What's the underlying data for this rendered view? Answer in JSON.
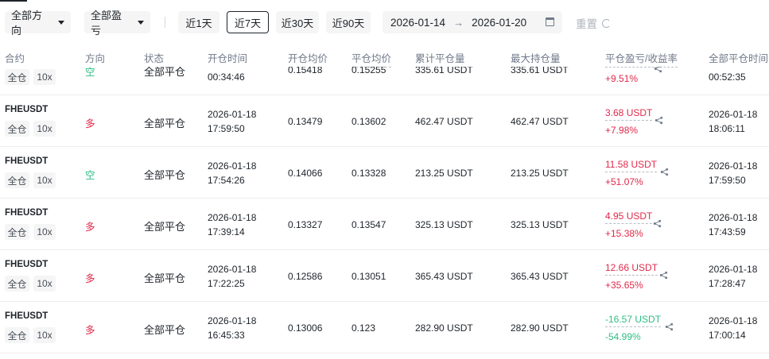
{
  "filters": {
    "direction": "全部方向",
    "pnl": "全部盈亏",
    "ranges": [
      "近1天",
      "近7天",
      "近30天",
      "近90天"
    ],
    "active_range": 1,
    "date_start": "2026-01-14",
    "date_end": "2026-01-20",
    "reset_label": "重置"
  },
  "columns": {
    "symbol": "合约",
    "side": "方向",
    "status": "状态",
    "open_time": "开仓时间",
    "open_avg": "开仓均价",
    "close_avg": "平仓均价",
    "cum_close": "累计平仓量",
    "max_hold": "最大持仓量",
    "pnl": "平仓盈亏/收益率",
    "close_time": "全部平仓时间"
  },
  "colors": {
    "long": "#e0294a",
    "short": "#2ebd85",
    "profit": "#e0294a",
    "loss": "#2ebd85"
  },
  "rows": [
    {
      "symbol": "",
      "margin": "全仓",
      "leverage": "10x",
      "side": "空",
      "side_type": "short",
      "status": "全部平仓",
      "open_date": "",
      "open_time": "00:34:46",
      "open_avg": "0.15418",
      "close_avg": "0.15255",
      "cum_close": "335.61 USDT",
      "max_hold": "335.61 USDT",
      "pnl": "",
      "pnl_rate": "+9.51%",
      "pnl_type": "profit",
      "close_date": "",
      "close_time": "00:52:35"
    },
    {
      "symbol": "FHEUSDT",
      "margin": "全仓",
      "leverage": "10x",
      "side": "多",
      "side_type": "long",
      "status": "全部平仓",
      "open_date": "2026-01-18",
      "open_time": "17:59:50",
      "open_avg": "0.13479",
      "close_avg": "0.13602",
      "cum_close": "462.47 USDT",
      "max_hold": "462.47 USDT",
      "pnl": "3.68 USDT",
      "pnl_rate": "+7.98%",
      "pnl_type": "profit",
      "close_date": "2026-01-18",
      "close_time": "18:06:11"
    },
    {
      "symbol": "FHEUSDT",
      "margin": "全仓",
      "leverage": "10x",
      "side": "空",
      "side_type": "short",
      "status": "全部平仓",
      "open_date": "2026-01-18",
      "open_time": "17:54:26",
      "open_avg": "0.14066",
      "close_avg": "0.13328",
      "cum_close": "213.25 USDT",
      "max_hold": "213.25 USDT",
      "pnl": "11.58 USDT",
      "pnl_rate": "+51.07%",
      "pnl_type": "profit",
      "close_date": "2026-01-18",
      "close_time": "17:59:50"
    },
    {
      "symbol": "FHEUSDT",
      "margin": "全仓",
      "leverage": "10x",
      "side": "多",
      "side_type": "long",
      "status": "全部平仓",
      "open_date": "2026-01-18",
      "open_time": "17:39:14",
      "open_avg": "0.13327",
      "close_avg": "0.13547",
      "cum_close": "325.13 USDT",
      "max_hold": "325.13 USDT",
      "pnl": "4.95 USDT",
      "pnl_rate": "+15.38%",
      "pnl_type": "profit",
      "close_date": "2026-01-18",
      "close_time": "17:43:59"
    },
    {
      "symbol": "FHEUSDT",
      "margin": "全仓",
      "leverage": "10x",
      "side": "多",
      "side_type": "long",
      "status": "全部平仓",
      "open_date": "2026-01-18",
      "open_time": "17:22:25",
      "open_avg": "0.12586",
      "close_avg": "0.13051",
      "cum_close": "365.43 USDT",
      "max_hold": "365.43 USDT",
      "pnl": "12.66 USDT",
      "pnl_rate": "+35.65%",
      "pnl_type": "profit",
      "close_date": "2026-01-18",
      "close_time": "17:28:47"
    },
    {
      "symbol": "FHEUSDT",
      "margin": "全仓",
      "leverage": "10x",
      "side": "多",
      "side_type": "long",
      "status": "全部平仓",
      "open_date": "2026-01-18",
      "open_time": "16:45:33",
      "open_avg": "0.13006",
      "close_avg": "0.123",
      "cum_close": "282.90 USDT",
      "max_hold": "282.90 USDT",
      "pnl": "-16.57 USDT",
      "pnl_rate": "-54.99%",
      "pnl_type": "loss",
      "close_date": "2026-01-18",
      "close_time": "17:00:14"
    }
  ]
}
